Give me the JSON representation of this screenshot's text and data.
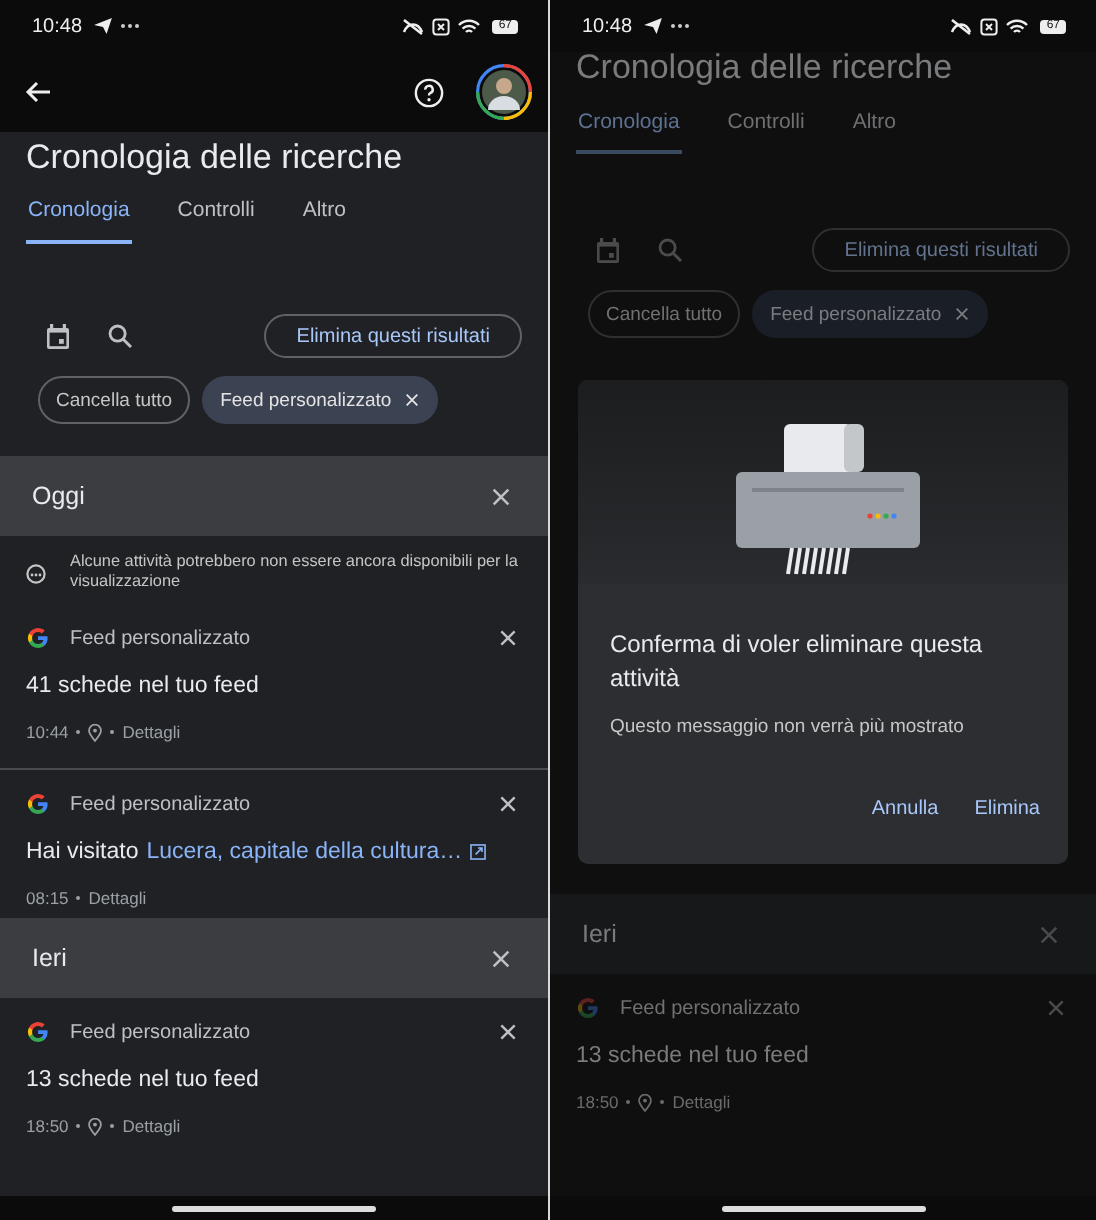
{
  "screens": [
    {
      "kind": "history",
      "status_bar": {
        "time": "10:48",
        "battery": "67"
      },
      "title": "Cronologia delle ricerche",
      "tabs": [
        {
          "label": "Cronologia",
          "selected": true
        },
        {
          "label": "Controlli",
          "selected": false
        },
        {
          "label": "Altro",
          "selected": false
        }
      ],
      "delete_button": "Elimina questi risultati",
      "chips": [
        {
          "label": "Cancella tutto",
          "selected": false
        },
        {
          "label": "Feed personalizzato",
          "selected": true
        }
      ],
      "sections": [
        {
          "heading": "Oggi",
          "notice": "Alcune attività potrebbero non essere ancora disponibili per la visualizzazione",
          "items": [
            {
              "source": "Feed personalizzato",
              "title": "41 schede nel tuo feed",
              "time": "10:44",
              "location": true,
              "details": "Dettagli"
            },
            {
              "source": "Feed personalizzato",
              "title": "Hai visitato",
              "link": "Lucera, capitale della cultura…",
              "time": "08:15",
              "location": false,
              "details": "Dettagli"
            }
          ]
        },
        {
          "heading": "Ieri",
          "items": [
            {
              "source": "Feed personalizzato",
              "title": "13 schede nel tuo feed",
              "time": "18:50",
              "location": true,
              "details": "Dettagli"
            }
          ]
        }
      ]
    },
    {
      "kind": "dialog",
      "status_bar": {
        "time": "10:48",
        "battery": "67"
      },
      "title": "Cronologia delle ricerche",
      "tabs": [
        {
          "label": "Cronologia",
          "selected": true
        },
        {
          "label": "Controlli",
          "selected": false
        },
        {
          "label": "Altro",
          "selected": false
        }
      ],
      "delete_button": "Elimina questi risultati",
      "chips": [
        {
          "label": "Cancella tutto",
          "selected": false
        },
        {
          "label": "Feed personalizzato",
          "selected": true
        }
      ],
      "dialog": {
        "title": "Conferma di voler eliminare questa attività",
        "message": "Questo messaggio non verrà più mostrato",
        "buttons": [
          "Annulla",
          "Elimina"
        ]
      },
      "sections": [
        {
          "heading": "Ieri",
          "items": [
            {
              "source": "Feed personalizzato",
              "title": "13 schede nel tuo feed",
              "time": "18:50",
              "location": true,
              "details": "Dettagli"
            }
          ]
        }
      ]
    }
  ]
}
